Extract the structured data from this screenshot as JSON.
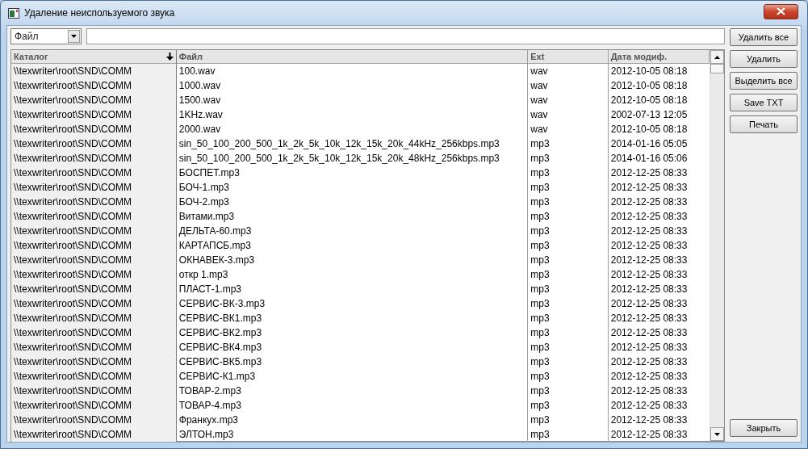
{
  "window": {
    "title": "Удаление неиспользуемого звука"
  },
  "filter": {
    "combo_value": "Файл"
  },
  "table": {
    "columns": [
      {
        "label": "Каталог",
        "sorted": true
      },
      {
        "label": "Файл",
        "sorted": false
      },
      {
        "label": "Ext",
        "sorted": false
      },
      {
        "label": "Дата модиф.",
        "sorted": false
      }
    ],
    "rows": [
      [
        "\\\\texwriter\\root\\SND\\COMM",
        "100.wav",
        "wav",
        "2012-10-05 08:18"
      ],
      [
        "\\\\texwriter\\root\\SND\\COMM",
        "1000.wav",
        "wav",
        "2012-10-05 08:18"
      ],
      [
        "\\\\texwriter\\root\\SND\\COMM",
        "1500.wav",
        "wav",
        "2012-10-05 08:18"
      ],
      [
        "\\\\texwriter\\root\\SND\\COMM",
        "1KHz.wav",
        "wav",
        "2002-07-13 12:05"
      ],
      [
        "\\\\texwriter\\root\\SND\\COMM",
        "2000.wav",
        "wav",
        "2012-10-05 08:18"
      ],
      [
        "\\\\texwriter\\root\\SND\\COMM",
        "sin_50_100_200_500_1k_2k_5k_10k_12k_15k_20k_44kHz_256kbps.mp3",
        "mp3",
        "2014-01-16 05:05"
      ],
      [
        "\\\\texwriter\\root\\SND\\COMM",
        "sin_50_100_200_500_1k_2k_5k_10k_12k_15k_20k_48kHz_256kbps.mp3",
        "mp3",
        "2014-01-16 05:06"
      ],
      [
        "\\\\texwriter\\root\\SND\\COMM",
        "БОСПЕТ.mp3",
        "mp3",
        "2012-12-25 08:33"
      ],
      [
        "\\\\texwriter\\root\\SND\\COMM",
        "БОЧ-1.mp3",
        "mp3",
        "2012-12-25 08:33"
      ],
      [
        "\\\\texwriter\\root\\SND\\COMM",
        "БОЧ-2.mp3",
        "mp3",
        "2012-12-25 08:33"
      ],
      [
        "\\\\texwriter\\root\\SND\\COMM",
        "Витами.mp3",
        "mp3",
        "2012-12-25 08:33"
      ],
      [
        "\\\\texwriter\\root\\SND\\COMM",
        "ДЕЛЬТА-60.mp3",
        "mp3",
        "2012-12-25 08:33"
      ],
      [
        "\\\\texwriter\\root\\SND\\COMM",
        "КАРТАПСБ.mp3",
        "mp3",
        "2012-12-25 08:33"
      ],
      [
        "\\\\texwriter\\root\\SND\\COMM",
        "ОКНАВЕК-3.mp3",
        "mp3",
        "2012-12-25 08:33"
      ],
      [
        "\\\\texwriter\\root\\SND\\COMM",
        "откр 1.mp3",
        "mp3",
        "2012-12-25 08:33"
      ],
      [
        "\\\\texwriter\\root\\SND\\COMM",
        "ПЛАСТ-1.mp3",
        "mp3",
        "2012-12-25 08:33"
      ],
      [
        "\\\\texwriter\\root\\SND\\COMM",
        "СЕРВИС-ВК-3.mp3",
        "mp3",
        "2012-12-25 08:33"
      ],
      [
        "\\\\texwriter\\root\\SND\\COMM",
        "СЕРВИС-ВК1.mp3",
        "mp3",
        "2012-12-25 08:33"
      ],
      [
        "\\\\texwriter\\root\\SND\\COMM",
        "СЕРВИС-ВК2.mp3",
        "mp3",
        "2012-12-25 08:33"
      ],
      [
        "\\\\texwriter\\root\\SND\\COMM",
        "СЕРВИС-ВК4.mp3",
        "mp3",
        "2012-12-25 08:33"
      ],
      [
        "\\\\texwriter\\root\\SND\\COMM",
        "СЕРВИС-ВК5.mp3",
        "mp3",
        "2012-12-25 08:33"
      ],
      [
        "\\\\texwriter\\root\\SND\\COMM",
        "СЕРВИС-К1.mp3",
        "mp3",
        "2012-12-25 08:33"
      ],
      [
        "\\\\texwriter\\root\\SND\\COMM",
        "ТОВАР-2.mp3",
        "mp3",
        "2012-12-25 08:33"
      ],
      [
        "\\\\texwriter\\root\\SND\\COMM",
        "ТОВАР-4.mp3",
        "mp3",
        "2012-12-25 08:33"
      ],
      [
        "\\\\texwriter\\root\\SND\\COMM",
        "Франкух.mp3",
        "mp3",
        "2012-12-25 08:33"
      ],
      [
        "\\\\texwriter\\root\\SND\\COMM",
        "ЭЛТОН.mp3",
        "mp3",
        "2012-12-25 08:33"
      ]
    ]
  },
  "buttons": [
    "Удалить все",
    "Удалить",
    "Выделить все",
    "Save TXT",
    "Печать"
  ],
  "close_button": "Закрыть"
}
